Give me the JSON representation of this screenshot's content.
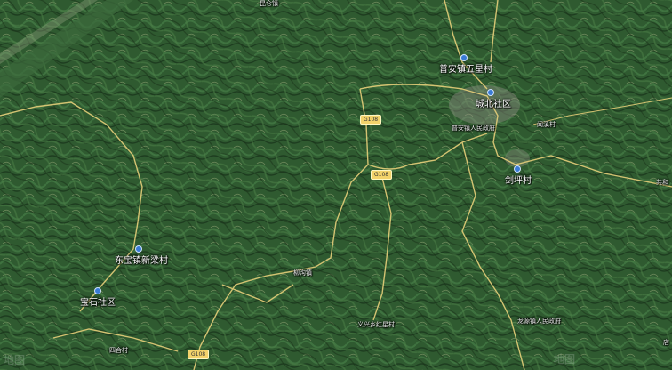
{
  "places": {
    "top_town": "昆仑镇",
    "wuxing": "普安镇五星村",
    "chengbei": "城北社区",
    "puan_gov": "普安镇人民政府",
    "minzhu": "闻溪村",
    "jianping": "剑坪村",
    "gongshe": "共和",
    "xinliang": "东宝镇新梁村",
    "baoshi": "宝石社区",
    "sihe": "四合村",
    "liangou": "柳沟镇",
    "yixing": "义兴乡红星村",
    "longyuan_gov": "龙源镇人民政府",
    "dianzi": "店"
  },
  "roads": {
    "g108": "G108",
    "s302": "G108",
    "bottom": "G108"
  },
  "watermark": "地图"
}
